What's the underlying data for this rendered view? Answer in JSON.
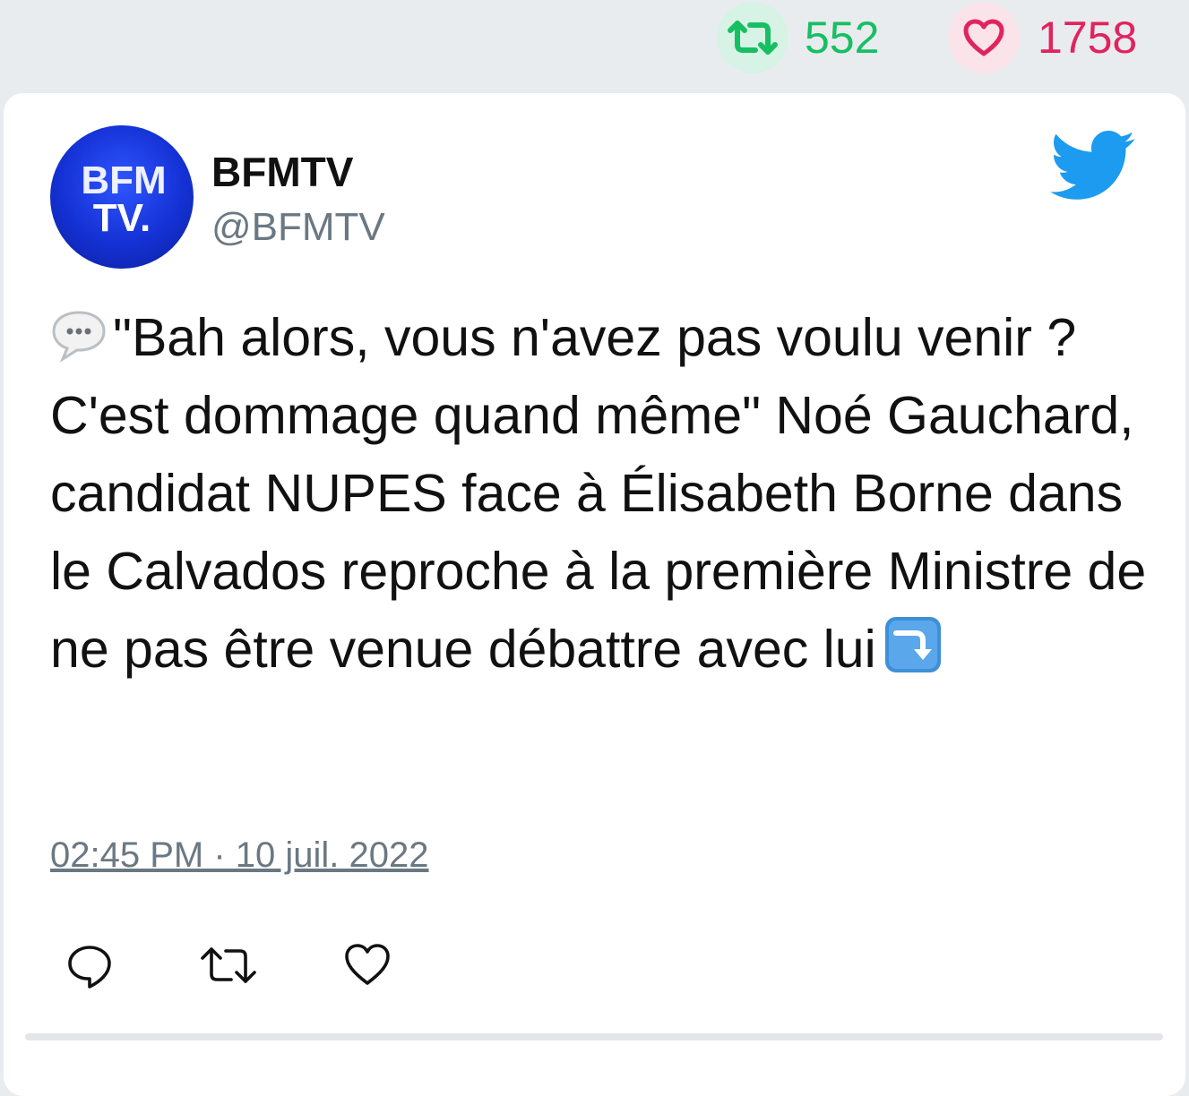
{
  "stats": {
    "retweets": "552",
    "likes": "1758",
    "retweet_color": "#17bf63",
    "like_color": "#e0245e"
  },
  "tweet": {
    "author_name": "BFMTV",
    "author_handle": "@BFMTV",
    "avatar_text_line1": "BFM",
    "avatar_text_line2": "TV.",
    "text": "\"Bah alors, vous n'avez pas voulu venir ? C'est dommage quand même\" Noé Gauchard, candidat NUPES face à Élisabeth Borne dans le Calvados reproche à la première Ministre de ne pas être venue débattre avec lui",
    "leading_emoji": "speech-bubble-icon",
    "trailing_emoji": "arrow-right-curving-down-icon",
    "timestamp": "02:45 PM · 10 juil. 2022"
  },
  "icons": {
    "brand": "twitter-bird-icon",
    "brand_color": "#1d9bf0",
    "actions": [
      "reply-icon",
      "retweet-icon",
      "like-icon"
    ]
  }
}
